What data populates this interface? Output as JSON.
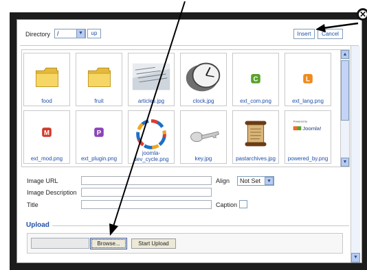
{
  "dialog": {
    "close_glyph": "✕",
    "directory_label": "Directory",
    "directory_value": "/",
    "up_label": "up",
    "insert_label": "Insert",
    "cancel_label": "Cancel"
  },
  "images": [
    {
      "caption": "food",
      "icon": "folder-icon"
    },
    {
      "caption": "fruit",
      "icon": "folder-icon"
    },
    {
      "caption": "articles.jpg",
      "icon": "articles-thumbnail"
    },
    {
      "caption": "clock.jpg",
      "icon": "clock-thumbnail"
    },
    {
      "caption": "ext_com.png",
      "icon": "ext-com-icon",
      "letter": "C",
      "color": "#5aa22b"
    },
    {
      "caption": "ext_lang.png",
      "icon": "ext-lang-icon",
      "letter": "L",
      "color": "#f08a1c"
    },
    {
      "caption": "ext_mod.png",
      "icon": "ext-mod-icon",
      "letter": "M",
      "color": "#d03a2a"
    },
    {
      "caption": "ext_plugin.png",
      "icon": "ext-plugin-icon",
      "letter": "P",
      "color": "#8b44b8"
    },
    {
      "caption": "joomla-dev_cycle.png",
      "icon": "dev-cycle-thumbnail"
    },
    {
      "caption": "key.jpg",
      "icon": "key-thumbnail"
    },
    {
      "caption": "pastarchives.jpg",
      "icon": "scroll-thumbnail"
    },
    {
      "caption": "powered_by.png",
      "icon": "joomla-logo-thumbnail",
      "logo_text": "Joomla!"
    }
  ],
  "form": {
    "image_url_label": "Image URL",
    "image_description_label": "Image Description",
    "title_label": "Title",
    "align_label": "Align",
    "align_value": "Not Set",
    "caption_label": "Caption"
  },
  "upload": {
    "legend": "Upload",
    "browse_label": "Browse...",
    "start_upload_label": "Start Upload"
  },
  "colors": {
    "accent": "#1f4ea8",
    "overlay": "#1c1c1c"
  }
}
